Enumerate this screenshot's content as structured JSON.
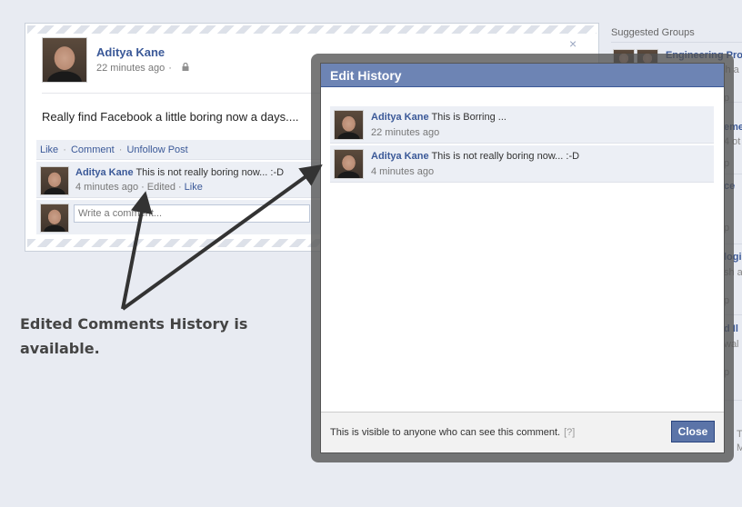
{
  "post": {
    "author": "Aditya Kane",
    "time": "22 minutes ago",
    "time_dot": "·",
    "text": "Really find Facebook a little boring now a days....",
    "close_glyph": "×",
    "actions": {
      "like": "Like",
      "comment": "Comment",
      "unfollow": "Unfollow Post",
      "sep": "·"
    }
  },
  "comment": {
    "author": "Aditya Kane",
    "text": "This is not really boring now... :-D",
    "time": "4 minutes ago",
    "edited": "Edited",
    "like": "Like",
    "sep": "·"
  },
  "write_comment": {
    "placeholder": "Write a comment..."
  },
  "sidebar": {
    "title": "Suggested Groups",
    "fragments": [
      "Engineering Pro",
      "sh a",
      "p",
      "eme",
      "4 ot",
      "p",
      "ce",
      "p",
      "logi",
      "sh a",
      "p",
      "d Il",
      "wal",
      "p",
      "T",
      "M"
    ]
  },
  "dialog": {
    "title": "Edit History",
    "history": [
      {
        "author": "Aditya Kane",
        "text": "This is Borring ...",
        "time": "22 minutes ago"
      },
      {
        "author": "Aditya Kane",
        "text": "This is not really boring now... :-D",
        "time": "4 minutes ago"
      }
    ],
    "footer_text": "This is visible to anyone who can see this comment.",
    "footer_help": "[?]",
    "close_label": "Close"
  },
  "annotation": {
    "text": "Edited Comments History is available."
  },
  "colors": {
    "link": "#3b5998",
    "dialog_header": "#6d84b4",
    "button": "#5b74a8",
    "page_bg": "#e8ebf2",
    "arrow": "#333333"
  },
  "icons": [
    "lock-icon",
    "close-icon",
    "arrow-icon"
  ]
}
